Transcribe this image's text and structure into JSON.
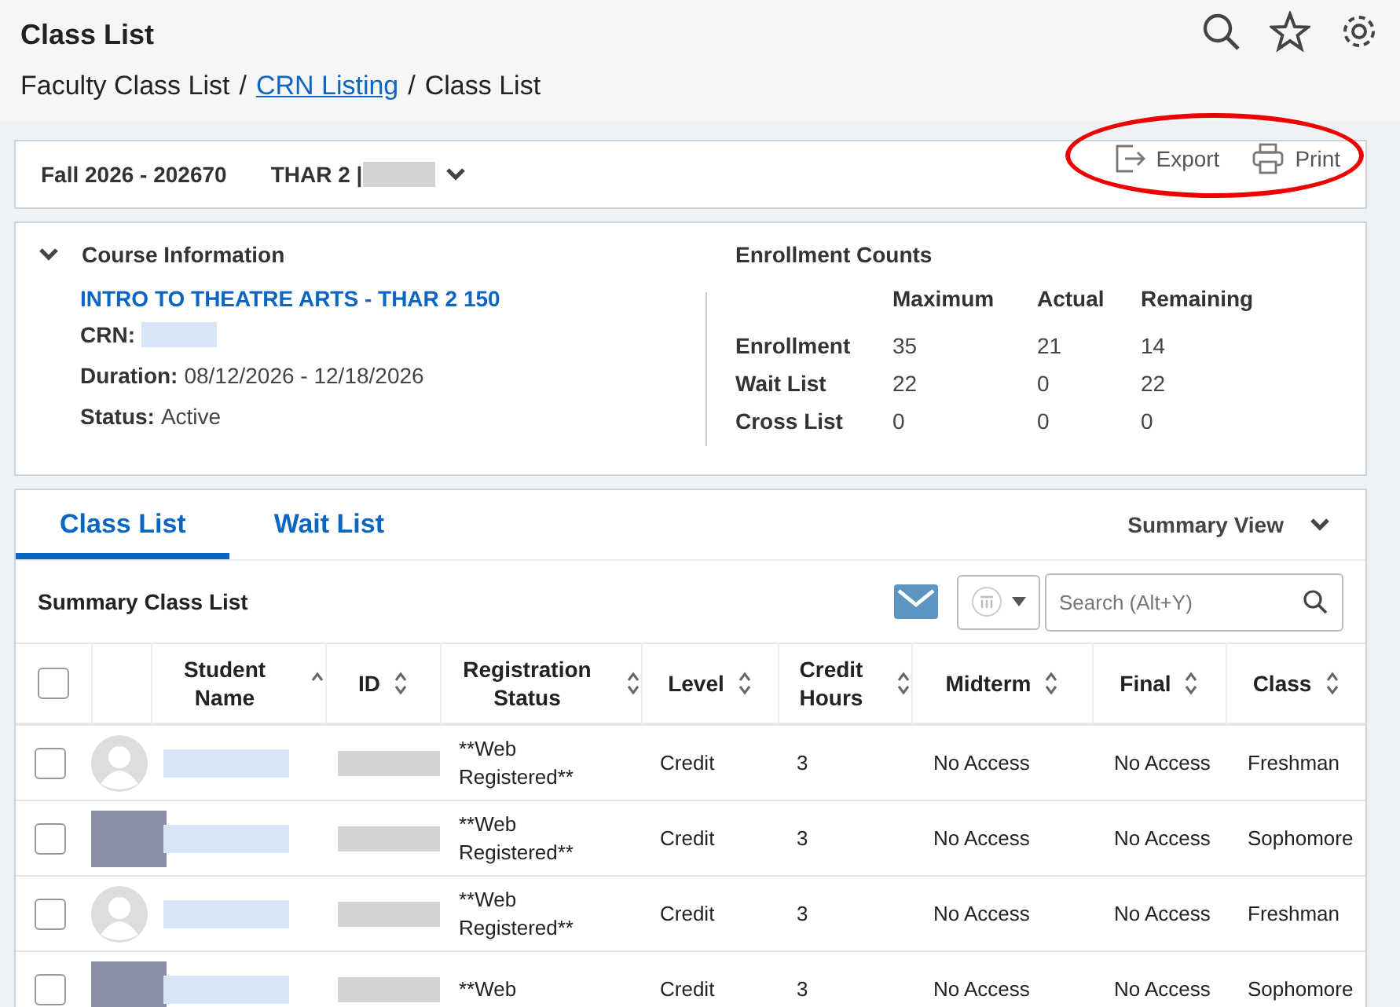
{
  "header": {
    "title": "Class List"
  },
  "breadcrumb": [
    {
      "label": "Faculty Class List",
      "kind": "text"
    },
    {
      "label": "/",
      "kind": "separator"
    },
    {
      "label": "CRN Listing",
      "kind": "link"
    },
    {
      "label": "/",
      "kind": "separator"
    },
    {
      "label": "Class List",
      "kind": "text"
    }
  ],
  "term_bar": {
    "term": "Fall 2026 - 202670",
    "course": "THAR 2 |",
    "actions": [
      {
        "label": "Export",
        "kind": "export"
      },
      {
        "label": "Print",
        "kind": "print"
      }
    ]
  },
  "course_info": {
    "heading": "Course Information",
    "expanded": true,
    "title": "INTRO TO THEATRE ARTS - THAR 2 150",
    "fields": [
      {
        "label": "CRN:",
        "kind": "redacted"
      },
      {
        "label": "Duration:",
        "value": "08/12/2026 - 12/18/2026",
        "kind": "text"
      },
      {
        "label": "Status:",
        "value": "Active",
        "kind": "text"
      }
    ]
  },
  "enrollment": {
    "heading": "Enrollment Counts",
    "columns": [
      "Maximum",
      "Actual",
      "Remaining"
    ],
    "rows": [
      {
        "label": "Enrollment",
        "values": [
          "35",
          "21",
          "14"
        ]
      },
      {
        "label": "Wait List",
        "values": [
          "22",
          "0",
          "22"
        ]
      },
      {
        "label": "Cross List",
        "values": [
          "0",
          "0",
          "0"
        ]
      }
    ]
  },
  "tabs": [
    {
      "label": "Class List",
      "selected": true
    },
    {
      "label": "Wait List",
      "selected": false
    }
  ],
  "view_selector": {
    "label": "Summary View"
  },
  "list_title": "Summary Class List",
  "search": {
    "placeholder": "Search (Alt+Y)"
  },
  "table": {
    "select_all": {
      "checked": false
    },
    "columns": [
      {
        "label": "Student Name",
        "sorted": true
      },
      {
        "label": "ID",
        "sorted": false
      },
      {
        "label": "Registration Status",
        "sorted": false
      },
      {
        "label": "Level",
        "sorted": false
      },
      {
        "label": "Credit Hours",
        "sorted": false
      },
      {
        "label": "Midterm",
        "sorted": false
      },
      {
        "label": "Final",
        "sorted": false
      },
      {
        "label": "Class",
        "sorted": false
      }
    ],
    "rows": [
      {
        "checked": false,
        "kind": "silhouette",
        "registration_status": "**Web Registered**",
        "level": "Credit",
        "credit_hours": "3",
        "midterm": "No Access",
        "final": "No Access",
        "class": "Freshman"
      },
      {
        "checked": false,
        "kind": "photo",
        "registration_status": "**Web Registered**",
        "level": "Credit",
        "credit_hours": "3",
        "midterm": "No Access",
        "final": "No Access",
        "class": "Sophomore"
      },
      {
        "checked": false,
        "kind": "silhouette",
        "registration_status": "**Web Registered**",
        "level": "Credit",
        "credit_hours": "3",
        "midterm": "No Access",
        "final": "No Access",
        "class": "Freshman"
      },
      {
        "checked": false,
        "kind": "photo",
        "registration_status": "**Web",
        "level": "Credit",
        "credit_hours": "3",
        "midterm": "No Access",
        "final": "No Access",
        "class": "Sophomore"
      }
    ]
  }
}
